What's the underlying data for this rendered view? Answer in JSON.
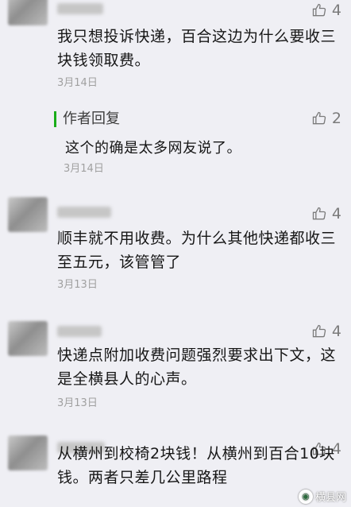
{
  "comments": [
    {
      "text": "我只想投诉快递，百合这边为什么要收三块钱领取费。",
      "date": "3月14日",
      "likes": "4",
      "reply": {
        "label": "作者回复",
        "likes": "2",
        "text": "这个的确是太多网友说了。",
        "date": "3月14日"
      }
    },
    {
      "text": "顺丰就不用收费。为什么其他快递都收三至五元，该管管了",
      "date": "3月13日",
      "likes": "4"
    },
    {
      "text": "快递点附加收费问题强烈要求出下文，这是全横县人的心声。",
      "date": "3月13日",
      "likes": "4"
    },
    {
      "text": "从横州到校椅2块钱！从横州到百合10块钱。两者只差几公里路程",
      "likes": "4"
    }
  ],
  "watermark": {
    "text": "横县网"
  },
  "colors": {
    "author_bar": "#1aad19",
    "background": "#efeff4"
  },
  "icons": {
    "like": "thumbs-up-icon",
    "watermark": "logo-icon"
  }
}
